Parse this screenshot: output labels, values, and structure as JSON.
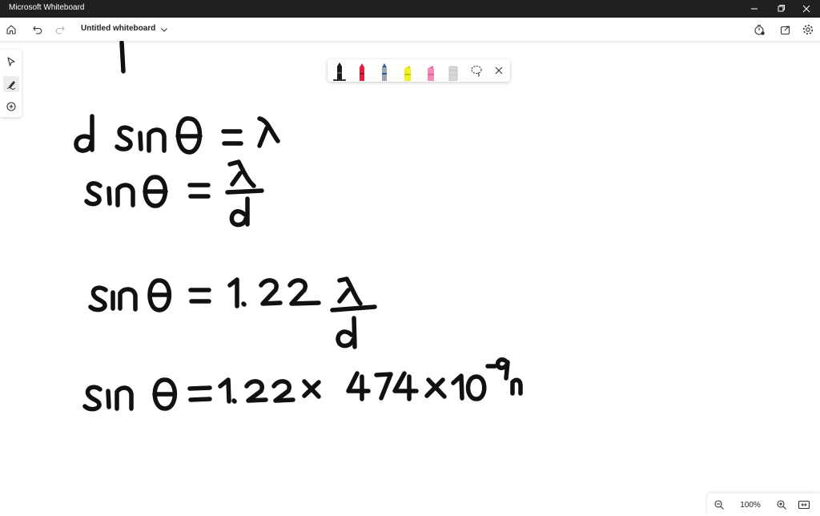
{
  "window": {
    "app_title": "Microsoft Whiteboard",
    "controls": [
      "minimize-icon",
      "restore-icon",
      "close-icon"
    ]
  },
  "toolbar": {
    "board_title": "Untitled whiteboard",
    "left_icons": [
      "home-icon",
      "undo-icon",
      "redo-icon"
    ],
    "right_icons": [
      "timer-icon",
      "share-icon",
      "settings-icon"
    ]
  },
  "left_rail": {
    "tools": [
      "select-icon",
      "inking-icon",
      "add-icon"
    ],
    "active_tool": "inking-icon"
  },
  "pen_tray": {
    "pens": [
      {
        "name": "black-pen",
        "color": "#1a1a1a",
        "selected": true
      },
      {
        "name": "red-pen",
        "color": "#e81d3c"
      },
      {
        "name": "blue-pen",
        "color": "#2f5fa8"
      },
      {
        "name": "highlighter-yellow",
        "color": "#f3f11f"
      },
      {
        "name": "highlighter-pink",
        "color": "#f48ab8"
      },
      {
        "name": "eraser",
        "color": "#d8d8d8"
      }
    ],
    "tools": [
      "lasso-icon",
      "close-icon"
    ]
  },
  "canvas": {
    "ink_strokes": [
      "d sinθ = λ",
      "sinθ = λ/d",
      "sinθ = 1.22 λ/d",
      "sinθ = 1.22 x 474 x 10^-9 m"
    ]
  },
  "zoom": {
    "level": "100%",
    "icons": [
      "zoom-out-icon",
      "zoom-in-icon",
      "fit-to-screen-icon"
    ]
  },
  "colors": {
    "titlebar": "#202020",
    "ink": "#111111"
  }
}
